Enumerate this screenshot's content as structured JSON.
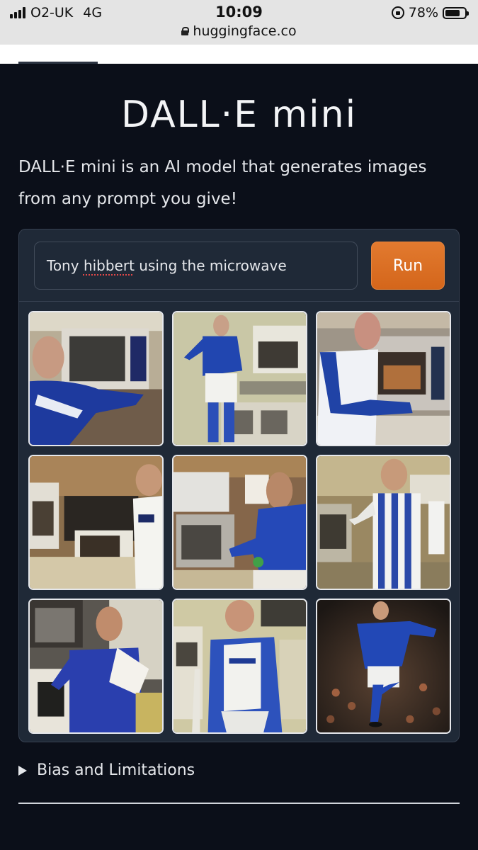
{
  "status_bar": {
    "carrier": "O2-UK",
    "network": "4G",
    "time": "10:09",
    "battery_percent": "78%",
    "battery_level": 0.78,
    "url": "huggingface.co"
  },
  "page": {
    "title": "DALL·E mini",
    "description": "DALL·E mini is an AI model that generates images from any prompt you give!"
  },
  "prompt": {
    "value_before": "Tony ",
    "value_misspelled": "hibbert",
    "value_after": " using the microwave"
  },
  "run_button": {
    "label": "Run"
  },
  "gallery": {
    "images": [
      {
        "label": "man in blue jersey beside microwave"
      },
      {
        "label": "footballer in blue kit in kitchen"
      },
      {
        "label": "man in blue-white jersey at microwave"
      },
      {
        "label": "microwave on counter, man in white shirt"
      },
      {
        "label": "man in blue shirt reaching into microwave"
      },
      {
        "label": "man in striped jersey in kitchen"
      },
      {
        "label": "man in blue top at oven"
      },
      {
        "label": "man in blue-white kit holding paper"
      },
      {
        "label": "footballer running on pitch"
      }
    ]
  },
  "accordion": {
    "label": "Bias and Limitations"
  },
  "colors": {
    "background": "#0b0f19",
    "panel": "#1f2937",
    "accent": "#e27a2f"
  }
}
